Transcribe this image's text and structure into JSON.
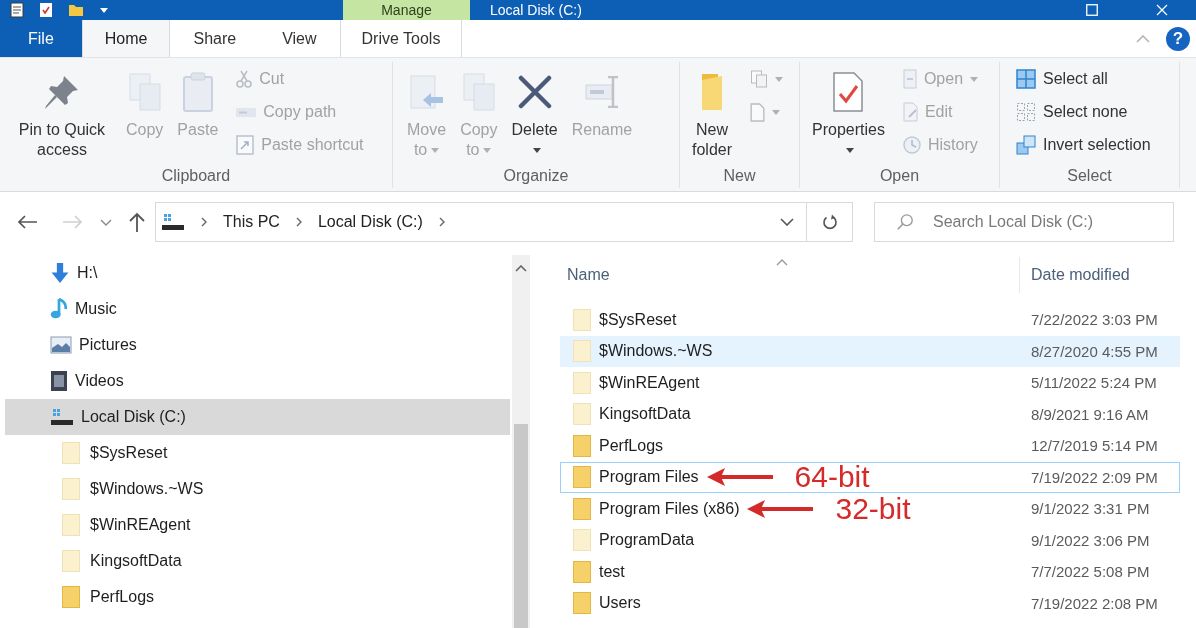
{
  "title_bar": {
    "contextual_tab": "Manage",
    "title": "Local Disk (C:)"
  },
  "ribbon_tabs": [
    {
      "label": "File",
      "kind": "file",
      "selected": false
    },
    {
      "label": "Home",
      "kind": "standard",
      "selected": true
    },
    {
      "label": "Share",
      "kind": "standard",
      "selected": false
    },
    {
      "label": "View",
      "kind": "standard",
      "selected": false
    },
    {
      "label": "Drive Tools",
      "kind": "contextual",
      "selected": false
    }
  ],
  "help_button": "?",
  "ribbon_groups": [
    {
      "label": "Clipboard",
      "large": [
        {
          "label": "Pin to Quick access",
          "disabled": false
        },
        {
          "label": "Copy",
          "disabled": true
        },
        {
          "label": "Paste",
          "disabled": true
        }
      ],
      "small": [
        {
          "label": "Cut",
          "disabled": true
        },
        {
          "label": "Copy path",
          "disabled": true
        },
        {
          "label": "Paste shortcut",
          "disabled": true
        }
      ]
    },
    {
      "label": "Organize",
      "large": [
        {
          "label": "Move to",
          "disabled": true,
          "dropdown": true
        },
        {
          "label": "Copy to",
          "disabled": true,
          "dropdown": true
        },
        {
          "label": "Delete",
          "disabled": false,
          "dropdown": true
        },
        {
          "label": "Rename",
          "disabled": true,
          "dropdown": false
        }
      ]
    },
    {
      "label": "New",
      "large": [
        {
          "label": "New folder",
          "disabled": false
        }
      ],
      "small": [
        {
          "disabled": true,
          "dropdown": true
        },
        {
          "disabled": true,
          "dropdown": true
        }
      ]
    },
    {
      "label": "Open",
      "large": [
        {
          "label": "Properties",
          "disabled": false,
          "dropdown": true
        }
      ],
      "small": [
        {
          "label": "Open",
          "disabled": true,
          "dropdown": true
        },
        {
          "label": "Edit",
          "disabled": true
        },
        {
          "label": "History",
          "disabled": true
        }
      ]
    },
    {
      "label": "Select",
      "small": [
        {
          "label": "Select all",
          "disabled": false
        },
        {
          "label": "Select none",
          "disabled": false
        },
        {
          "label": "Invert selection",
          "disabled": false
        }
      ]
    }
  ],
  "address_bar": {
    "nav_buttons": [
      {
        "disabled": false
      },
      {
        "disabled": true
      },
      {
        "disabled": false
      },
      {
        "disabled": false
      }
    ],
    "path": [
      "This PC",
      "Local Disk (C:)"
    ],
    "search_placeholder": "Search Local Disk (C:)"
  },
  "navigation_pane": {
    "items": [
      {
        "label": "H:\\",
        "selected": false
      },
      {
        "label": "Music",
        "selected": false
      },
      {
        "label": "Pictures",
        "selected": false
      },
      {
        "label": "Videos",
        "selected": false
      },
      {
        "label": "Local Disk (C:)",
        "selected": true,
        "children": [
          {
            "label": "$SysReset",
            "hidden": true,
            "selected": false
          },
          {
            "label": "$Windows.~WS",
            "hidden": true,
            "selected": false
          },
          {
            "label": "$WinREAgent",
            "hidden": true,
            "selected": false
          },
          {
            "label": "KingsoftData",
            "hidden": true,
            "selected": false
          },
          {
            "label": "PerfLogs",
            "hidden": false,
            "selected": false
          }
        ]
      }
    ]
  },
  "file_list": {
    "columns": [
      {
        "label": "Name",
        "sorted": true
      },
      {
        "label": "Date modified",
        "sorted": false
      }
    ],
    "rows": [
      {
        "name": "$SysReset",
        "date_modified": "7/22/2022 3:03 PM",
        "hidden": true,
        "selected": false,
        "hovered": false,
        "focused": false
      },
      {
        "name": "$Windows.~WS",
        "date_modified": "8/27/2020 4:55 PM",
        "hidden": true,
        "selected": false,
        "hovered": true,
        "focused": false
      },
      {
        "name": "$WinREAgent",
        "date_modified": "5/11/2022 5:24 PM",
        "hidden": true,
        "selected": false,
        "hovered": false,
        "focused": false
      },
      {
        "name": "KingsoftData",
        "date_modified": "8/9/2021 9:16 AM",
        "hidden": true,
        "selected": false,
        "hovered": false,
        "focused": false
      },
      {
        "name": "PerfLogs",
        "date_modified": "12/7/2019 5:14 PM",
        "hidden": false,
        "selected": false,
        "hovered": false,
        "focused": false
      },
      {
        "name": "Program Files",
        "date_modified": "7/19/2022 2:09 PM",
        "hidden": false,
        "selected": false,
        "hovered": false,
        "focused": true,
        "annotation": "64-bit"
      },
      {
        "name": "Program Files (x86)",
        "date_modified": "9/1/2022 3:31 PM",
        "hidden": false,
        "selected": false,
        "hovered": false,
        "focused": false,
        "annotation": "32-bit"
      },
      {
        "name": "ProgramData",
        "date_modified": "9/1/2022 3:06 PM",
        "hidden": true,
        "selected": false,
        "hovered": false,
        "focused": false
      },
      {
        "name": "test",
        "date_modified": "7/7/2022 5:08 PM",
        "hidden": false,
        "selected": false,
        "hovered": false,
        "focused": false
      },
      {
        "name": "Users",
        "date_modified": "7/19/2022 2:08 PM",
        "hidden": false,
        "selected": false,
        "hovered": false,
        "focused": false
      }
    ]
  }
}
